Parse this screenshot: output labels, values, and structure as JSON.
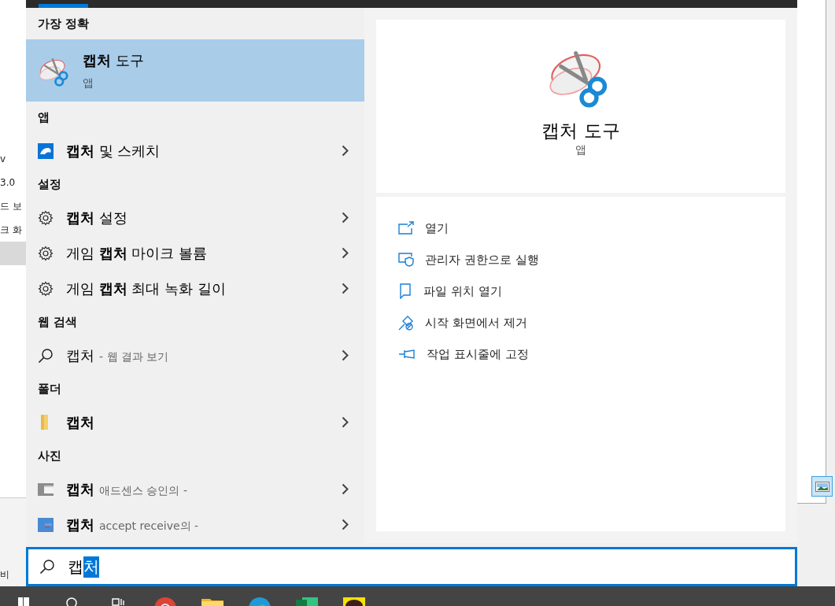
{
  "background_window": {
    "fragments": [
      "v",
      "3.0",
      "드 보",
      "크 화",
      "비"
    ]
  },
  "results": {
    "best_match": {
      "heading": "가장 정확",
      "title": "**캡처** 도구",
      "subtitle": "앱",
      "selected": true
    },
    "groups": [
      {
        "heading": "앱",
        "items": [
          {
            "kind": "app",
            "label": "**캡처** 및 스케치"
          }
        ]
      },
      {
        "heading": "설정",
        "items": [
          {
            "kind": "setting",
            "label": "**캡처** 설정"
          },
          {
            "kind": "setting",
            "label": "게임 **캡처** 마이크 볼륨"
          },
          {
            "kind": "setting",
            "label": "게임 **캡처** 최대 녹화 길이"
          }
        ]
      },
      {
        "heading": "웹 검색",
        "items": [
          {
            "kind": "web",
            "label": "캡처",
            "suffix": "- 웹 결과 보기"
          }
        ]
      },
      {
        "heading": "폴더",
        "items": [
          {
            "kind": "folder",
            "label": "캡처"
          }
        ]
      },
      {
        "heading": "사진",
        "items": [
          {
            "label": "캡처",
            "suffix": "애드센스 승인의 -"
          },
          {
            "kind": "photo-blue",
            "label": "캡처",
            "suffix": "accept receive의 -"
          }
        ]
      }
    ]
  },
  "preview": {
    "title": "캡처 도구",
    "subtitle": "앱",
    "actions": [
      {
        "kind": "open",
        "label": "열기"
      },
      {
        "kind": "admin",
        "label": "관리자 권한으로 실행"
      },
      {
        "kind": "location",
        "label": "파일 위치 열기"
      },
      {
        "kind": "unpin",
        "label": "시작 화면에서 제거"
      },
      {
        "kind": "pin",
        "label": "작업 표시줄에 고정"
      }
    ]
  },
  "search_box": {
    "text": "캡",
    "selected_text": "처"
  },
  "taskbar": {
    "apps": [
      {
        "kind": "start"
      },
      {
        "kind": "search"
      },
      {
        "kind": "taskview"
      },
      {
        "kind": "browser"
      },
      {
        "kind": "files"
      },
      {
        "kind": "edge"
      },
      {
        "kind": "sheet"
      },
      {
        "kind": "chat"
      }
    ]
  }
}
